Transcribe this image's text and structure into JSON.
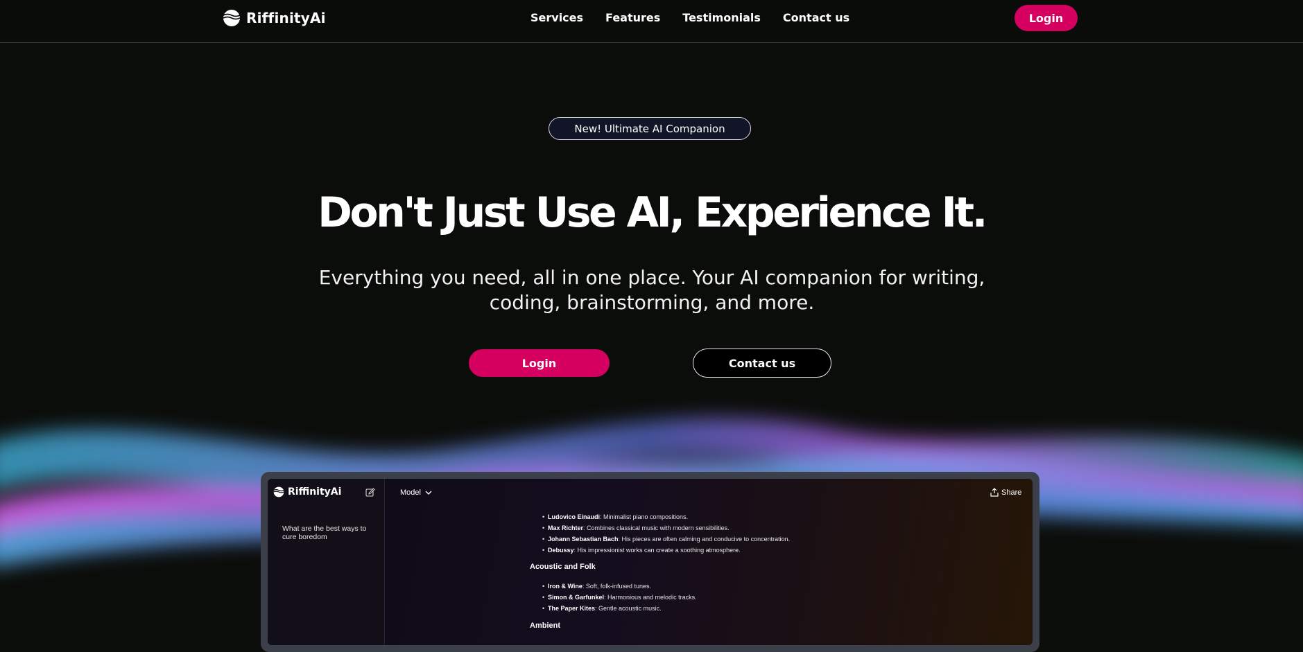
{
  "nav": {
    "brand": "RiffinityAi",
    "links": [
      "Services",
      "Features",
      "Testimonials",
      "Contact us"
    ],
    "login_label": "Login"
  },
  "hero": {
    "badge": "New! Ultimate AI Companion",
    "headline": "Don't Just Use AI, Experience It.",
    "subtitle": "Everything you need, all in one place. Your AI companion for writing, coding, brainstorming, and more.",
    "login_label": "Login",
    "contact_label": "Contact us"
  },
  "preview": {
    "brand": "RiffinityAi",
    "history_item": "What are the best ways to cure boredom",
    "model_label": "Model",
    "share_label": "Share",
    "classical_items": [
      {
        "name": "Ludovico Einaudi",
        "desc": ": Minimalist piano compositions."
      },
      {
        "name": "Max Richter",
        "desc": ": Combines classical music with modern sensibilities."
      },
      {
        "name": "Johann Sebastian Bach",
        "desc": ": His pieces are often calming and conducive to concentration."
      },
      {
        "name": "Debussy",
        "desc": ": His impressionist works can create a soothing atmosphere."
      }
    ],
    "acoustic_heading": "Acoustic and Folk",
    "acoustic_items": [
      {
        "name": "Iron & Wine",
        "desc": ": Soft, folk-infused tunes."
      },
      {
        "name": "Simon & Garfunkel",
        "desc": ": Harmonious and melodic tracks."
      },
      {
        "name": "The Paper Kites",
        "desc": ": Gentle acoustic music."
      }
    ],
    "ambient_heading": "Ambient"
  },
  "colors": {
    "accent": "#d5005f",
    "background": "#0b0d0a",
    "badge_bg": "#121528"
  },
  "icons": {
    "logo": "riffinity-logo-icon",
    "edit": "edit-icon",
    "model_chevron": "chevron-down-icon",
    "share": "share-icon"
  }
}
